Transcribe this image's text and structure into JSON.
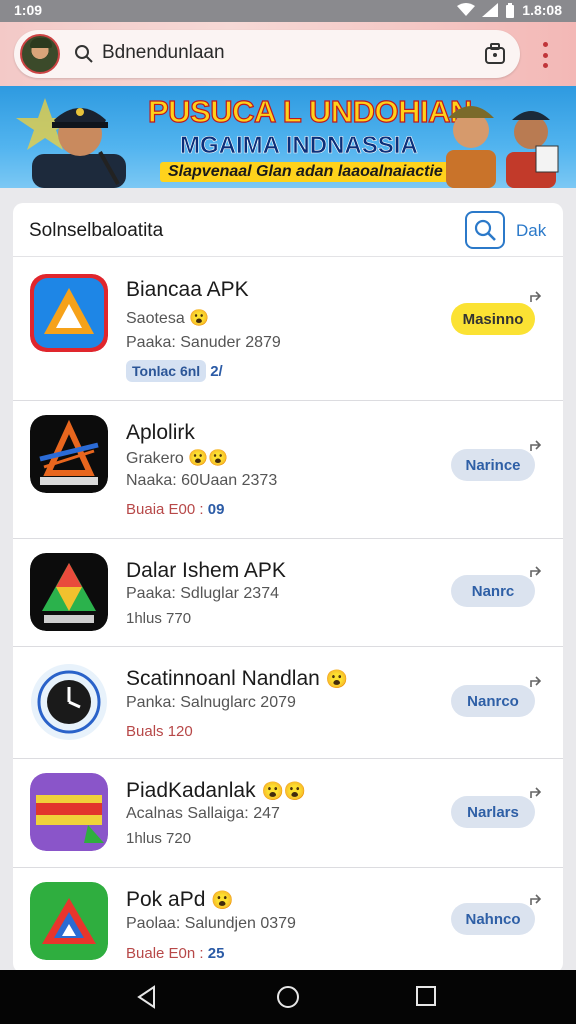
{
  "status_bar": {
    "time": "1:09",
    "clock_right": "1.8:08",
    "icons": [
      "wifi-icon",
      "signal-icon",
      "battery-icon"
    ]
  },
  "browser": {
    "url": "Bdnendunlaan",
    "icons": [
      "avatar",
      "search-icon",
      "tabs-icon",
      "more-menu-icon"
    ]
  },
  "banner": {
    "line1": "PUSUCA L UNDOHIAN",
    "line2": "MGAIMA INDNASSIA",
    "line3": "Slapvenaal Glan adan laaoalnaiactie"
  },
  "list": {
    "title": "Solnselbaloatita",
    "header_link": "Dak",
    "apps": [
      {
        "name": "Biancaa APK",
        "emoji": "😮",
        "sub": "Saotesa",
        "detail": "Paaka: Sanuder 2879",
        "meta_chip": "Tonlac 6nl",
        "meta_tail": "2/",
        "meta_prefix": "",
        "meta_value": "",
        "button": "Masinno",
        "button_style": "yellow",
        "icon_colors": [
          "#1e86e6",
          "#f6a21a",
          "#e0262d"
        ]
      },
      {
        "name": "Aplolirk",
        "emoji": "😮😮",
        "sub": "Grakero",
        "detail": "Naaka: 60Uaan 2373",
        "meta_chip": "",
        "meta_tail": "",
        "meta_prefix": "Buaia E00 :",
        "meta_value": "09",
        "button": "Narince",
        "button_style": "blue",
        "icon_colors": [
          "#0c0c0c",
          "#e8661e",
          "#2b6bd6"
        ]
      },
      {
        "name": "Dalar Ishem APK",
        "emoji": "",
        "sub": "Paaka: Sdluglar 2374",
        "detail": "",
        "meta_chip": "",
        "meta_tail": "",
        "meta_prefix": "1hlus 770",
        "meta_value": "",
        "button": "Nanrc",
        "button_style": "blue",
        "icon_colors": [
          "#0c0c0c",
          "#2bb24c",
          "#e94b3c"
        ]
      },
      {
        "name": "Scatinnoanl Nandlan",
        "emoji": "😮",
        "sub": "Panka: Salnuglarc 2079",
        "detail": "",
        "meta_chip": "",
        "meta_tail": "",
        "meta_prefix": "Buals 120",
        "meta_value": "",
        "button": "Nanrco",
        "button_style": "blue",
        "icon_colors": [
          "#ffffff",
          "#1a1a1a",
          "#2a62c9"
        ]
      },
      {
        "name": "PiadKadanlak",
        "emoji": "😮😮",
        "sub": "Acalnas Sallaiga: 247",
        "detail": "",
        "meta_chip": "",
        "meta_tail": "",
        "meta_prefix": "1hlus 720",
        "meta_value": "",
        "button": "Narlars",
        "button_style": "blue",
        "icon_colors": [
          "#8a55c9",
          "#f0d23a",
          "#e2362c"
        ]
      },
      {
        "name": "Pok aPd",
        "emoji": "😮",
        "sub": "Paolaa: Salundjen 0379",
        "detail": "",
        "meta_chip": "",
        "meta_tail": "",
        "meta_prefix": "Buale E0n :",
        "meta_value": "25",
        "button": "Nahnco",
        "button_style": "blue",
        "icon_colors": [
          "#2fae3f",
          "#e8352c",
          "#2a6bd3"
        ]
      }
    ]
  },
  "nav_bar": {
    "icons": [
      "back-icon",
      "home-icon",
      "recents-icon"
    ]
  },
  "colors": {
    "accent": "#2b79c9",
    "install_yellow": "#fbe233",
    "install_blue_bg": "#dbe3ef"
  }
}
